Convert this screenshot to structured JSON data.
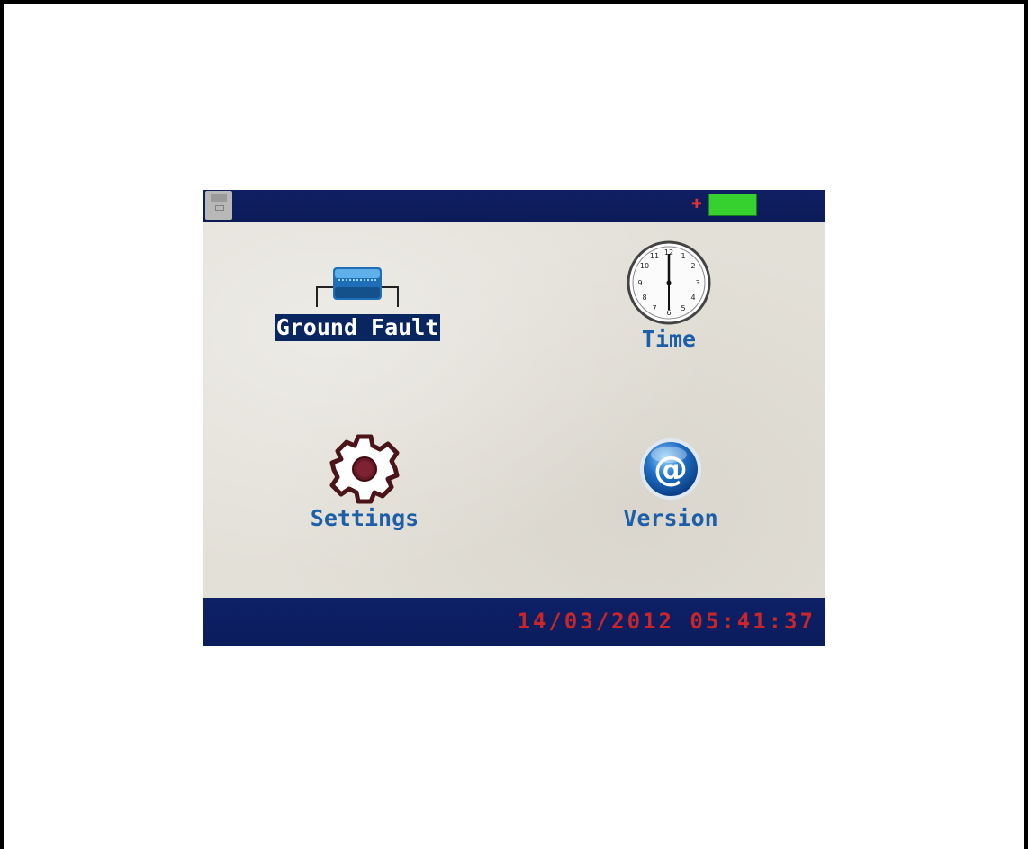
{
  "status_bar": {
    "usb_icon": "usb-drive-icon",
    "power_icon": "plug-icon",
    "battery_icon": "battery-icon",
    "battery_level": 1.0,
    "battery_color": "#36d12f"
  },
  "menu": {
    "items": [
      {
        "label": "Ground Fault",
        "icon": "ground-fault-resistor-icon",
        "selected": true
      },
      {
        "label": "Time",
        "icon": "clock-icon",
        "selected": false
      },
      {
        "label": "Settings",
        "icon": "gear-icon",
        "selected": false
      },
      {
        "label": "Version",
        "icon": "at-sign-icon",
        "selected": false
      }
    ]
  },
  "footer": {
    "datetime": "14/03/2012 05:41:37"
  },
  "colors": {
    "bar_background": "#0e2067",
    "label_text": "#1c5fa8",
    "selected_background": "#0a2660",
    "datetime_text": "#c8262a",
    "screen_background": "#e3e0d8"
  }
}
